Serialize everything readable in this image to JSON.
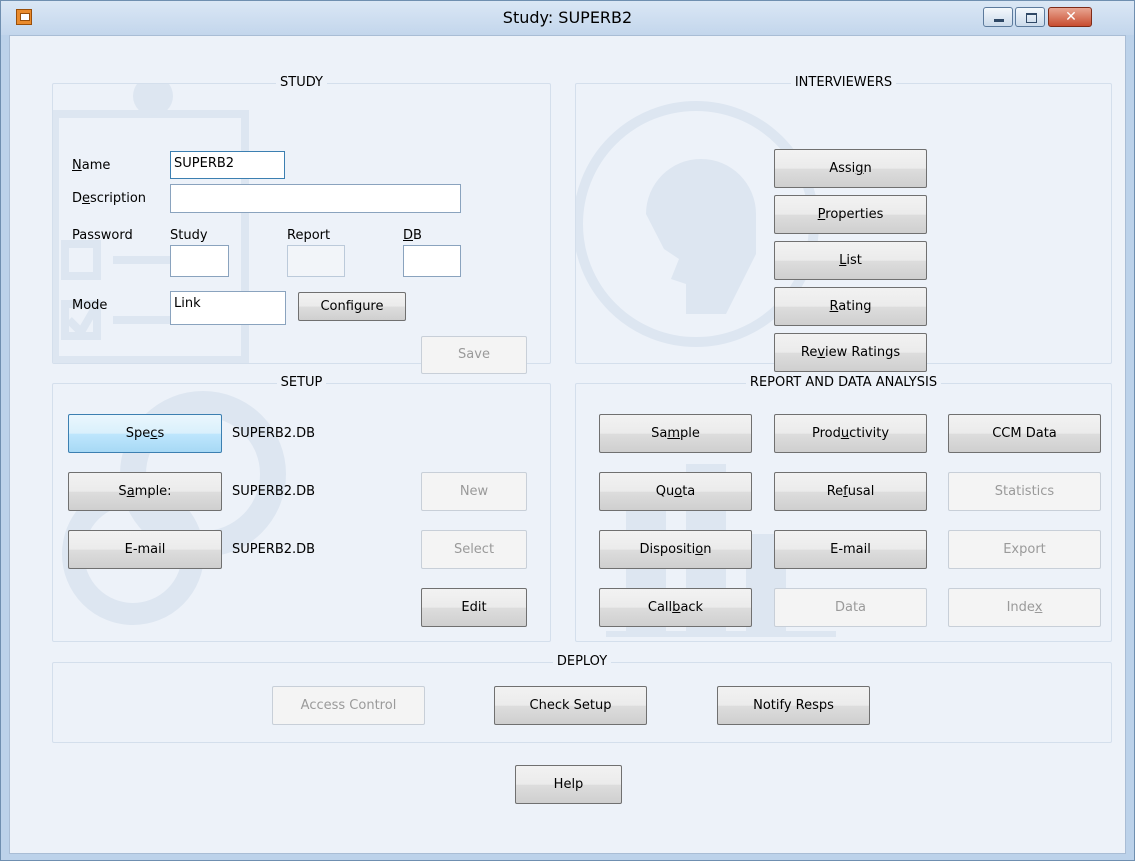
{
  "window": {
    "title": "Study: SUPERB2",
    "controls": {
      "minimize": "–",
      "maximize": "□",
      "close": "✕"
    }
  },
  "study": {
    "title": "STUDY",
    "name_label": [
      "",
      "N",
      "ame"
    ],
    "name_value": "SUPERB2",
    "description_label": [
      "D",
      "e",
      "scription"
    ],
    "description_value": "",
    "password_label": "Password",
    "study_label": "Study",
    "report_label": "Report",
    "db_label": [
      "",
      "D",
      "B"
    ],
    "mode_label": "Mode",
    "mode_value": "Link",
    "configure_label": "Configure",
    "save_label": "Save"
  },
  "interviewers": {
    "title": "INTERVIEWERS",
    "assign": [
      "Assi",
      "g",
      "n"
    ],
    "properties": [
      "",
      "P",
      "roperties"
    ],
    "list": [
      "",
      "L",
      "ist"
    ],
    "rating": [
      "",
      "R",
      "ating"
    ],
    "review": [
      "Re",
      "v",
      "iew Ratings"
    ]
  },
  "setup": {
    "title": "SETUP",
    "specs": [
      "Spe",
      "c",
      "s"
    ],
    "specs_db": "SUPERB2.DB",
    "sample": [
      "S",
      "a",
      "mple:"
    ],
    "sample_db": "SUPERB2.DB",
    "email": [
      "E-mail",
      "",
      ""
    ],
    "email_db": "SUPERB2.DB",
    "new_label": "New",
    "select_label": "Select",
    "edit_label": "Edit"
  },
  "report": {
    "title": "REPORT AND DATA ANALYSIS",
    "sample": [
      "Sa",
      "m",
      "ple"
    ],
    "productivity": [
      "Prod",
      "u",
      "ctivity"
    ],
    "ccm": "CCM Data",
    "quota": [
      "Qu",
      "o",
      "ta"
    ],
    "refusal": [
      "Re",
      "f",
      "usal"
    ],
    "statistics": "Statistics",
    "disposition": [
      "Dispositi",
      "o",
      "n"
    ],
    "email": "E-mail",
    "export": "Export",
    "callback": [
      "Call",
      "b",
      "ack"
    ],
    "data": "Data",
    "index": [
      "Inde",
      "x",
      ""
    ]
  },
  "deploy": {
    "title": "DEPLOY",
    "access_control": "Access Control",
    "check_setup": "Check Setup",
    "notify": "Notify Resps"
  },
  "help_label": "Help"
}
